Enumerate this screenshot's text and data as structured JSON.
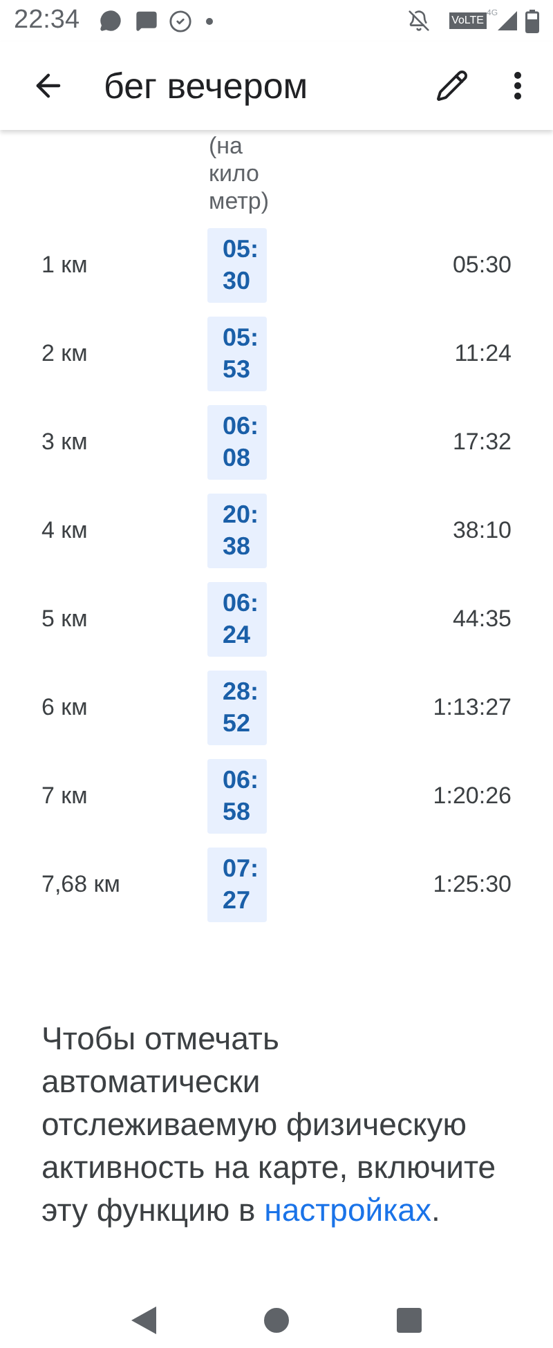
{
  "status_bar": {
    "time": "22:34",
    "network": "VoLTE",
    "network_type": "4G"
  },
  "toolbar": {
    "title": "бег вечером"
  },
  "table": {
    "pace_header": "(на кило метр)",
    "rows": [
      {
        "distance": "1 км",
        "pace": [
          "05:",
          "30"
        ],
        "total": "05:30"
      },
      {
        "distance": "2 км",
        "pace": [
          "05:",
          "53"
        ],
        "total": "11:24"
      },
      {
        "distance": "3 км",
        "pace": [
          "06:",
          "08"
        ],
        "total": "17:32"
      },
      {
        "distance": "4 км",
        "pace": [
          "20:",
          "38"
        ],
        "total": "38:10"
      },
      {
        "distance": "5 км",
        "pace": [
          "06:",
          "24"
        ],
        "total": "44:35"
      },
      {
        "distance": "6 км",
        "pace": [
          "28:",
          "52"
        ],
        "total": "1:13:27"
      },
      {
        "distance": "7 км",
        "pace": [
          "06:",
          "58"
        ],
        "total": "1:20:26"
      },
      {
        "distance": "7,68 км",
        "pace": [
          "07:",
          "27"
        ],
        "total": "1:25:30"
      }
    ]
  },
  "note": {
    "text": "Чтобы отмечать автоматически отслеживаемую физическую активность на карте, включите эту функцию в",
    "link": "настройках",
    "end": "."
  }
}
